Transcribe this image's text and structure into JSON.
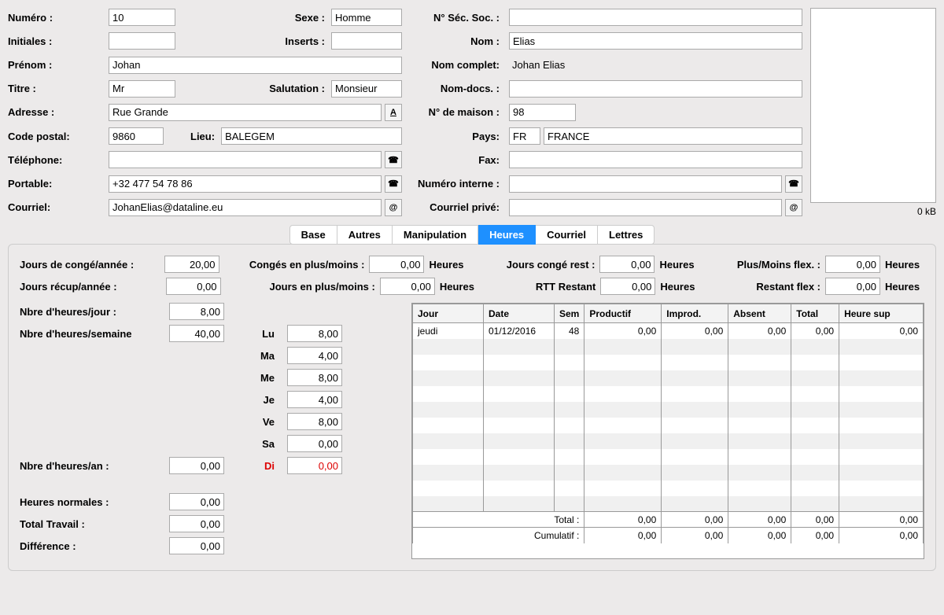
{
  "labels": {
    "numero": "Numéro :",
    "sexe": "Sexe :",
    "secsoc": "N° Séc. Soc. :",
    "initiales": "Initiales :",
    "inserts": "Inserts :",
    "nom": "Nom :",
    "prenom": "Prénom :",
    "nomcomplet": "Nom complet:",
    "titre": "Titre :",
    "salutation": "Salutation :",
    "nomdocs": "Nom-docs. :",
    "adresse": "Adresse :",
    "nmaison": "N° de maison :",
    "codepostal": "Code postal:",
    "lieu": "Lieu:",
    "pays": "Pays:",
    "telephone": "Téléphone:",
    "fax": "Fax:",
    "portable": "Portable:",
    "numinterne": "Numéro interne :",
    "courriel": "Courriel:",
    "courrielprive": "Courriel privé:",
    "kb": "0 kB"
  },
  "fields": {
    "numero": "10",
    "sexe": "Homme",
    "secsoc": "",
    "initiales": "",
    "inserts": "",
    "nom": "Elias",
    "prenom": "Johan",
    "nomcomplet": "Johan Elias",
    "titre": "Mr",
    "salutation": "Monsieur",
    "nomdocs": "",
    "adresse": "Rue Grande",
    "nmaison": "98",
    "codepostal": "9860",
    "lieu": "BALEGEM",
    "payscode": "FR",
    "paysnom": "FRANCE",
    "telephone": "",
    "fax": "",
    "portable": "+32 477 54 78 86",
    "numinterne": "",
    "courriel": "JohanElias@dataline.eu",
    "courrielprive": ""
  },
  "icons": {
    "address": "A",
    "phone": "☎",
    "email": "@"
  },
  "tabs": [
    "Base",
    "Autres",
    "Manipulation",
    "Heures",
    "Courriel",
    "Lettres"
  ],
  "activeTab": "Heures",
  "heures": {
    "row1": {
      "conge_an_lbl": "Jours de congé/année :",
      "conge_an": "20,00",
      "conge_pm_lbl": "Congés en plus/moins :",
      "conge_pm": "0,00",
      "u1": "Heures",
      "conge_rest_lbl": "Jours congé rest :",
      "conge_rest": "0,00",
      "u2": "Heures",
      "flex_pm_lbl": "Plus/Moins flex. :",
      "flex_pm": "0,00",
      "u3": "Heures"
    },
    "row2": {
      "recup_an_lbl": "Jours récup/année :",
      "recup_an": "0,00",
      "jours_pm_lbl": "Jours en plus/moins :",
      "jours_pm": "0,00",
      "u1": "Heures",
      "rtt_lbl": "RTT Restant",
      "rtt": "0,00",
      "u2": "Heures",
      "flex_rest_lbl": "Restant flex :",
      "flex_rest": "0,00",
      "u3": "Heures"
    },
    "left": {
      "hjour_lbl": "Nbre d'heures/jour :",
      "hjour": "8,00",
      "hsem_lbl": "Nbre d'heures/semaine",
      "hsem": "40,00",
      "han_lbl": "Nbre d'heures/an :",
      "han": "0,00",
      "norm_lbl": "Heures normales :",
      "norm": "0,00",
      "tot_lbl": "Total Travail :",
      "tot": "0,00",
      "diff_lbl": "Différence :",
      "diff": "0,00"
    },
    "days": [
      {
        "lbl": "Lu",
        "val": "8,00"
      },
      {
        "lbl": "Ma",
        "val": "4,00"
      },
      {
        "lbl": "Me",
        "val": "8,00"
      },
      {
        "lbl": "Je",
        "val": "4,00"
      },
      {
        "lbl": "Ve",
        "val": "8,00"
      },
      {
        "lbl": "Sa",
        "val": "0,00"
      },
      {
        "lbl": "Di",
        "val": "0,00"
      }
    ]
  },
  "table": {
    "headers": [
      "Jour",
      "Date",
      "Sem",
      "Productif",
      "Improd.",
      "Absent",
      "Total",
      "Heure sup"
    ],
    "row": {
      "jour": "jeudi",
      "date": "01/12/2016",
      "sem": "48",
      "productif": "0,00",
      "improd": "0,00",
      "absent": "0,00",
      "total": "0,00",
      "sup": "0,00"
    },
    "footer": {
      "total_lbl": "Total :",
      "cumul_lbl": "Cumulatif :",
      "productif": "0,00",
      "improd": "0,00",
      "absent": "0,00",
      "total": "0,00",
      "sup": "0,00",
      "c_productif": "0,00",
      "c_improd": "0,00",
      "c_absent": "0,00",
      "c_total": "0,00",
      "c_sup": "0,00"
    }
  }
}
